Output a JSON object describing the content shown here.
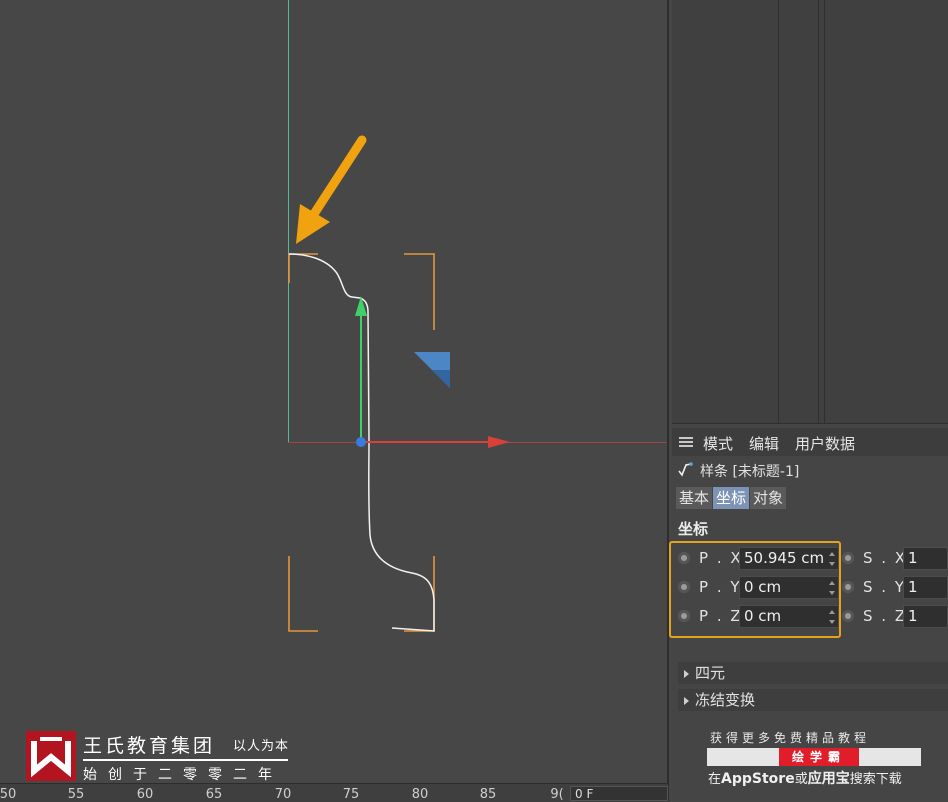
{
  "ruler": {
    "ticks": [
      "50",
      "55",
      "60",
      "65",
      "70",
      "75",
      "80",
      "85",
      "9("
    ],
    "frame": "0 F"
  },
  "attributes": {
    "menu": [
      "模式",
      "编辑",
      "用户数据"
    ],
    "object_title": "样条 [未标题-1]",
    "tabs": [
      {
        "label": "基本",
        "active": false
      },
      {
        "label": "坐标",
        "active": true
      },
      {
        "label": "对象",
        "active": false
      }
    ],
    "section_title": "坐标",
    "fields": {
      "px": {
        "label": "P . X",
        "value": "50.945 cm"
      },
      "py": {
        "label": "P . Y",
        "value": "0 cm"
      },
      "pz": {
        "label": "P . Z",
        "value": "0 cm"
      },
      "sx": {
        "label": "S . X",
        "value": "1"
      },
      "sy": {
        "label": "S . Y",
        "value": "1"
      },
      "sz": {
        "label": "S . Z",
        "value": "1"
      }
    },
    "collapsed": [
      "四元",
      "冻结变换"
    ]
  },
  "promo": {
    "top": "获得更多免费精品教程",
    "badge": "绘学霸",
    "bottom_pre": "在",
    "bottom_app": "AppStore",
    "bottom_mid": "或",
    "bottom_store": "应用宝",
    "bottom_post": "搜索下载"
  },
  "watermark": {
    "title": "王氏教育集团",
    "slogan": "以人为本",
    "sub": "始创于二零零二年"
  },
  "colors": {
    "highlight": "#e5a21c",
    "axis_x": "#d9403a",
    "axis_y": "#3fcf6b",
    "bbox": "#e3953b",
    "logo": "#b2151f",
    "active_tab": "#7c93b6"
  }
}
